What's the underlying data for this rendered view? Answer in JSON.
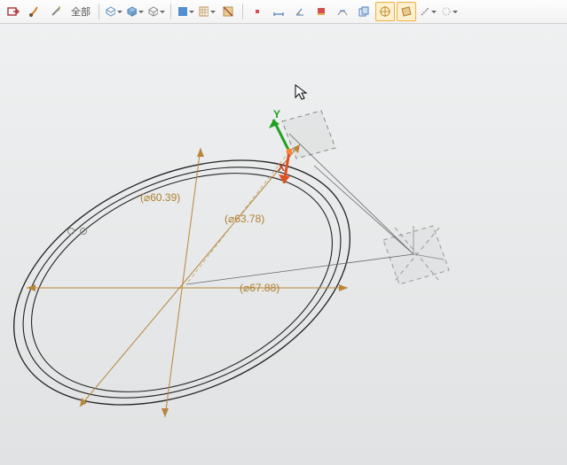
{
  "toolbar": {
    "exit_sketch": "exit",
    "brush": "brush",
    "wand": "wand",
    "scope_label": "全部",
    "view_cube": "cube",
    "solid_dd": "solid",
    "wire_dd": "wire",
    "face_dd": "face",
    "grid_dd": "grid",
    "section": "section",
    "dim1": "dim1",
    "dim2": "dim2",
    "dim3": "dim3",
    "layer": "layer",
    "tangent": "tangent",
    "copy": "copy",
    "target": "target",
    "plane": "plane",
    "axis": "axis",
    "spin": "spin"
  },
  "sketch": {
    "dim_diam1": "(⌀60.39)",
    "dim_diam2": "(⌀63.78)",
    "dim_diam3": "(⌀67.88)",
    "axis_y": "Y",
    "axis_x": "X"
  }
}
